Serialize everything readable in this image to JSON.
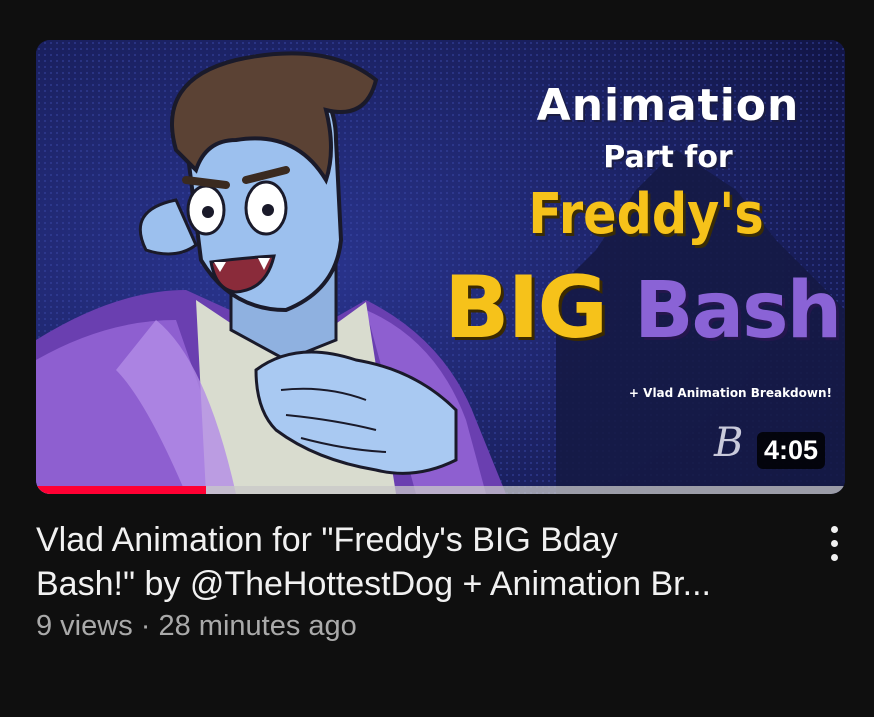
{
  "video": {
    "thumbnail": {
      "line1": "Animation",
      "line2": "Part for",
      "line3": "Freddy's",
      "line4a": "BIG",
      "line4b": "Bash!",
      "subline": "+ Vlad Animation Breakdown!",
      "signature": "B",
      "duration": "4:05"
    },
    "progress": 0.21,
    "title_line1": "Vlad Animation for \"Freddy's BIG Bday",
    "title_line2": "Bash!\" by @TheHottestDog + Animation Br...",
    "meta": "9 views · 28 minutes ago",
    "menu_icon": "more-vertical-icon"
  },
  "colors": {
    "background": "#0f0f0f",
    "progress": "#ff0033",
    "title": "#f1f1f1",
    "meta": "#aaaaaa",
    "accent_yellow": "#f6c21a",
    "accent_purple": "#8a63d6"
  }
}
